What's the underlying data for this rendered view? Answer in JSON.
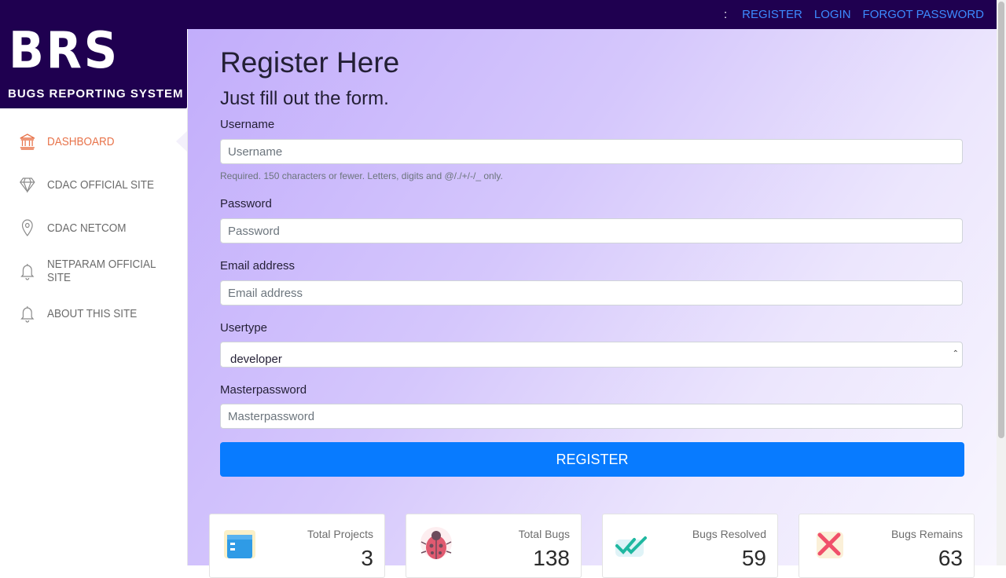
{
  "topnav": {
    "separator": ":",
    "links": [
      {
        "label": "REGISTER"
      },
      {
        "label": "LOGIN"
      },
      {
        "label": "FORGOT PASSWORD"
      }
    ]
  },
  "logo": {
    "text": "BRS",
    "subtitle": "BUGS REPORTING SYSTEM"
  },
  "sidebar": {
    "items": [
      {
        "label": "DASHBOARD",
        "icon": "bank-icon",
        "active": true
      },
      {
        "label": "CDAC OFFICIAL SITE",
        "icon": "diamond-icon"
      },
      {
        "label": "CDAC NETCOM",
        "icon": "location-pin-icon"
      },
      {
        "label": "NETPARAM OFFICIAL SITE",
        "icon": "bell-icon"
      },
      {
        "label": "ABOUT THIS SITE",
        "icon": "bell-icon"
      }
    ]
  },
  "form": {
    "title": "Register Here",
    "subtitle": "Just fill out the form.",
    "username": {
      "label": "Username",
      "placeholder": "Username",
      "help": "Required. 150 characters or fewer. Letters, digits and @/./+/-/_ only."
    },
    "password": {
      "label": "Password",
      "placeholder": "Password"
    },
    "email": {
      "label": "Email address",
      "placeholder": "Email address"
    },
    "usertype": {
      "label": "Usertype",
      "value": "developer"
    },
    "masterpassword": {
      "label": "Masterpassword",
      "placeholder": "Masterpassword"
    },
    "submit_label": "REGISTER"
  },
  "stats": [
    {
      "title": "Total Projects",
      "value": "3",
      "icon": "folder-icon"
    },
    {
      "title": "Total Bugs",
      "value": "138",
      "icon": "bug-icon"
    },
    {
      "title": "Bugs Resolved",
      "value": "59",
      "icon": "double-check-icon"
    },
    {
      "title": "Bugs Remains",
      "value": "63",
      "icon": "close-x-icon"
    }
  ],
  "colors": {
    "topbar": "#1f0050",
    "link": "#3d8bff",
    "active_nav": "#e8734a",
    "button": "#087bff"
  }
}
